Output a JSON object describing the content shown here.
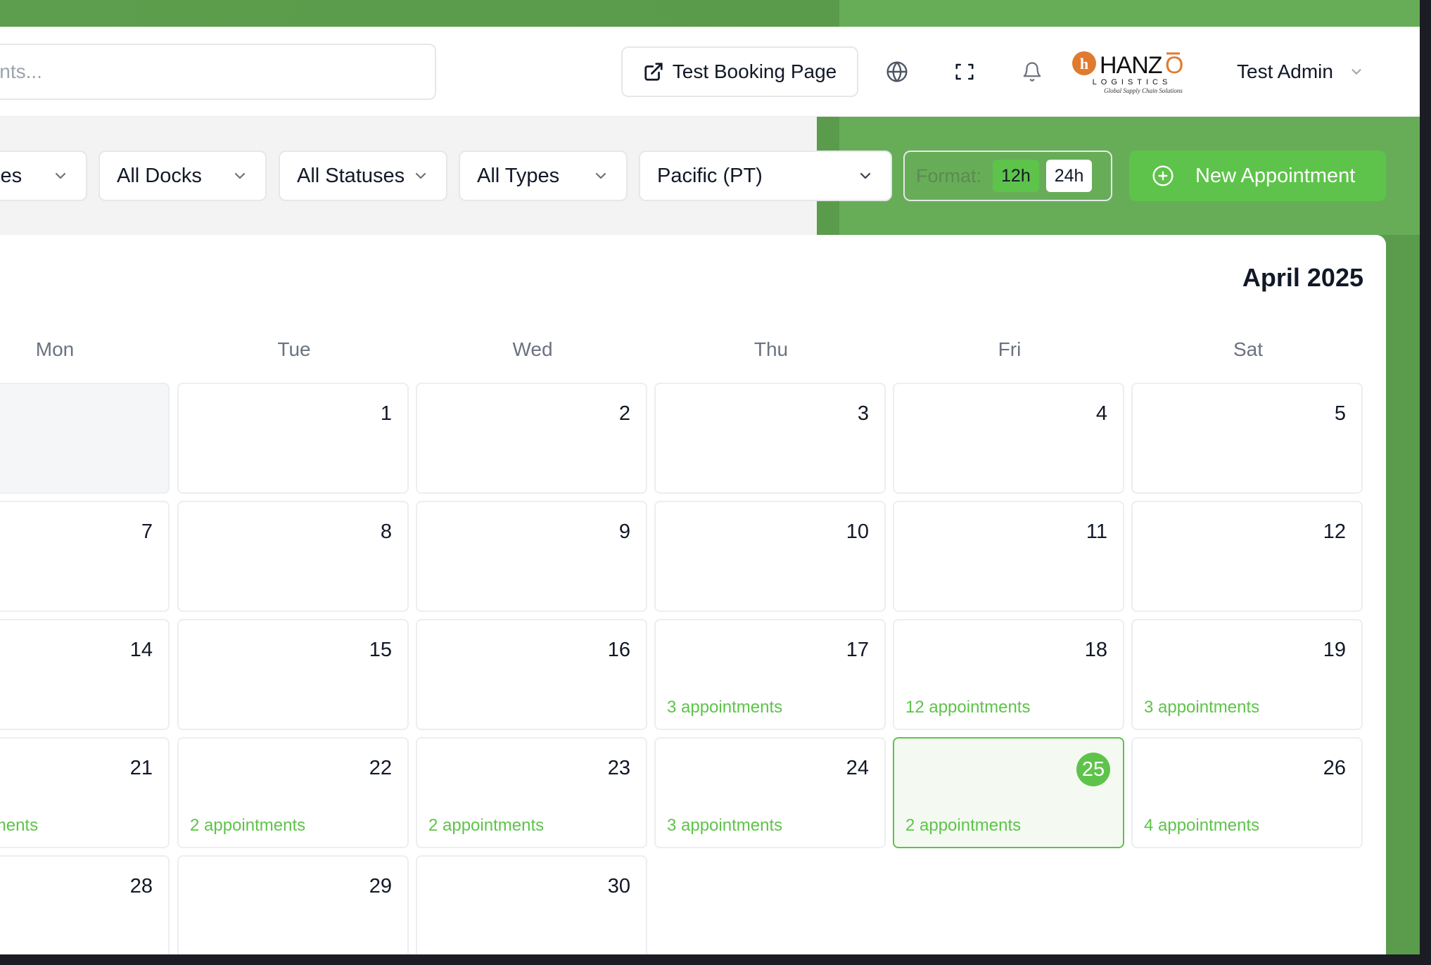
{
  "header": {
    "search_placeholder": "Search appointments...",
    "test_booking_label": "Test Booking Page",
    "icons": [
      "external-link-icon",
      "globe-icon",
      "fullscreen-icon",
      "bell-icon"
    ],
    "logo": {
      "brand": "HANZŌ",
      "sub": "LOGISTICS",
      "tagline": "Global Supply Chain Solutions"
    },
    "user_name": "Test Admin"
  },
  "filters": {
    "facilities": "All Facilities",
    "docks": "All Docks",
    "statuses": "All Statuses",
    "types": "All Types",
    "timezone": "Pacific (PT)",
    "format_label": "Format:",
    "format_12h": "12h",
    "format_24h": "24h",
    "selected_format": "12h",
    "new_appointment_label": "New Appointment"
  },
  "calendar": {
    "month_title": "April 2025",
    "weekdays": [
      "Mon",
      "Tue",
      "Wed",
      "Thu",
      "Fri",
      "Sat"
    ],
    "today": "25",
    "weeks": [
      [
        {
          "day": "",
          "appts": ""
        },
        {
          "day": "1",
          "appts": ""
        },
        {
          "day": "2",
          "appts": ""
        },
        {
          "day": "3",
          "appts": ""
        },
        {
          "day": "4",
          "appts": ""
        },
        {
          "day": "5",
          "appts": ""
        }
      ],
      [
        {
          "day": "7",
          "appts": ""
        },
        {
          "day": "8",
          "appts": ""
        },
        {
          "day": "9",
          "appts": ""
        },
        {
          "day": "10",
          "appts": ""
        },
        {
          "day": "11",
          "appts": ""
        },
        {
          "day": "12",
          "appts": ""
        }
      ],
      [
        {
          "day": "14",
          "appts": ""
        },
        {
          "day": "15",
          "appts": ""
        },
        {
          "day": "16",
          "appts": ""
        },
        {
          "day": "17",
          "appts": "3 appointments"
        },
        {
          "day": "18",
          "appts": "12 appointments"
        },
        {
          "day": "19",
          "appts": "3 appointments"
        }
      ],
      [
        {
          "day": "21",
          "appts": "appointments"
        },
        {
          "day": "22",
          "appts": "2 appointments"
        },
        {
          "day": "23",
          "appts": "2 appointments"
        },
        {
          "day": "24",
          "appts": "3 appointments"
        },
        {
          "day": "25",
          "appts": "2 appointments"
        },
        {
          "day": "26",
          "appts": "4 appointments"
        }
      ],
      [
        {
          "day": "28",
          "appts": ""
        },
        {
          "day": "29",
          "appts": ""
        },
        {
          "day": "30",
          "appts": ""
        }
      ]
    ]
  },
  "colors": {
    "accent": "#5ec34a",
    "panel_green": "#5b9c4c",
    "logo_orange": "#e07a2e"
  }
}
